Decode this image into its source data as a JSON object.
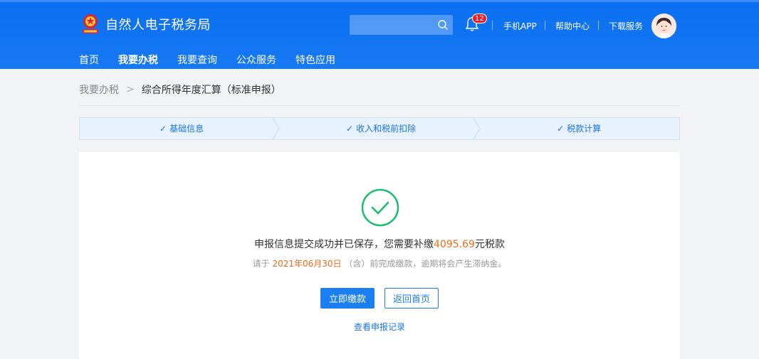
{
  "header": {
    "title": "自然人电子税务局",
    "search": {
      "placeholder": ""
    },
    "notification_count": "12",
    "links": [
      "手机APP",
      "帮助中心",
      "下载服务"
    ]
  },
  "nav": {
    "items": [
      "首页",
      "我要办税",
      "我要查询",
      "公众服务",
      "特色应用"
    ],
    "active_index": 1
  },
  "breadcrumb": {
    "parent": "我要办税",
    "separator": ">",
    "current": "综合所得年度汇算（标准申报）"
  },
  "steps": [
    {
      "label": "基础信息",
      "check": "✓"
    },
    {
      "label": "收入和税前扣除",
      "check": "✓"
    },
    {
      "label": "税款计算",
      "check": "✓"
    }
  ],
  "result": {
    "message_prefix": "申报信息提交成功并已保存，您需要补缴",
    "amount": "4095.69",
    "message_suffix": "元税款",
    "sub_prefix": "请于 ",
    "deadline": "2021年06月30日",
    "sub_suffix": " （含）前完成缴款，逾期将会产生滞纳金。",
    "pay_button": "立即缴款",
    "home_button": "返回首页",
    "records_link": "查看申报记录"
  },
  "colors": {
    "header_bg": "#0a6ff0",
    "accent": "#1a7ff0",
    "amount": "#f06b19",
    "success": "#19be6b",
    "badge": "#e5202c"
  },
  "icons": [
    "emblem-icon",
    "search-icon",
    "bell-icon",
    "avatar",
    "check-icon",
    "success-check-icon"
  ]
}
